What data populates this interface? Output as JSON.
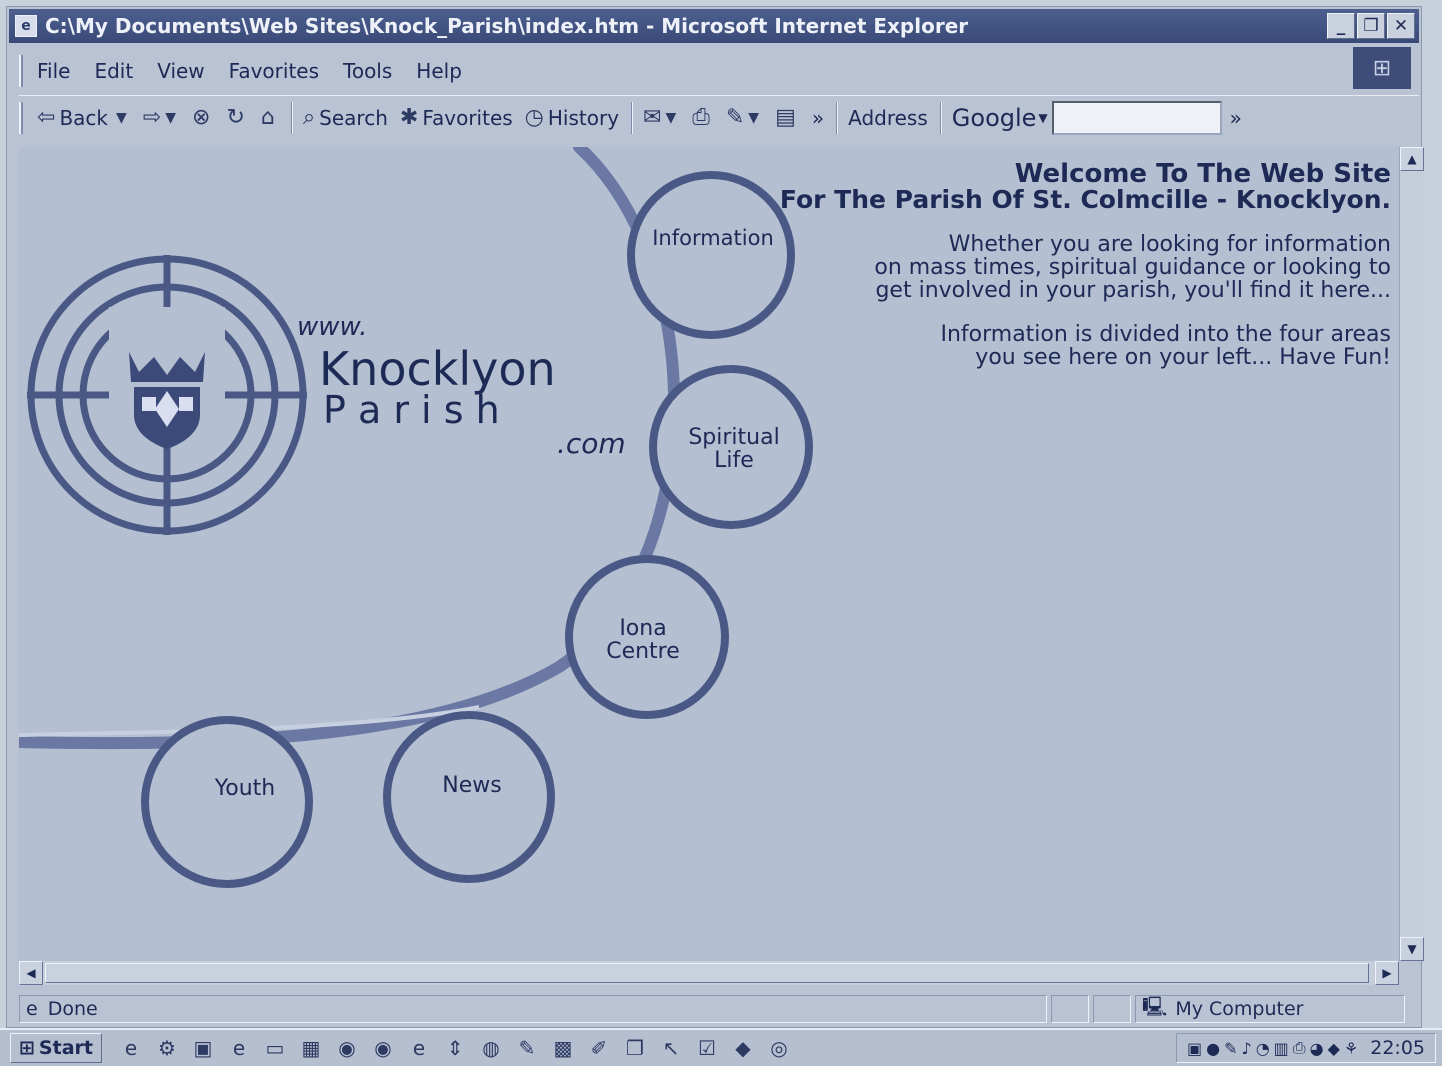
{
  "window": {
    "title": "C:\\My Documents\\Web Sites\\Knock_Parish\\index.htm - Microsoft Internet Explorer"
  },
  "menu": [
    "File",
    "Edit",
    "View",
    "Favorites",
    "Tools",
    "Help"
  ],
  "toolbar": {
    "back": "Back",
    "search": "Search",
    "favorites": "Favorites",
    "history": "History",
    "chevron": "»",
    "address": "Address",
    "google": "Google",
    "chevron2": "»"
  },
  "page": {
    "logo_www": "www.",
    "logo_name": "Knocklyon",
    "logo_parish": "P a r i s h",
    "logo_com": ".com",
    "welcome_line1": "Welcome To The Web Site",
    "welcome_line2": "For The Parish Of St. Colmcille - Knocklyon.",
    "intro": [
      "Whether you are looking for information",
      "on mass times, spiritual guidance or looking to",
      "get involved in your parish, you'll find it here..."
    ],
    "info": [
      "Information is divided into the four areas",
      "you see here on your left... Have Fun!"
    ],
    "nav": {
      "information": "Information",
      "spiritual_1": "Spiritual",
      "spiritual_2": "Life",
      "iona_1": "Iona",
      "iona_2": "Centre",
      "news": "News",
      "youth": "Youth"
    }
  },
  "status": {
    "text": "Done",
    "zone": "My Computer"
  },
  "taskbar": {
    "start": "Start",
    "clock": "22:05"
  }
}
